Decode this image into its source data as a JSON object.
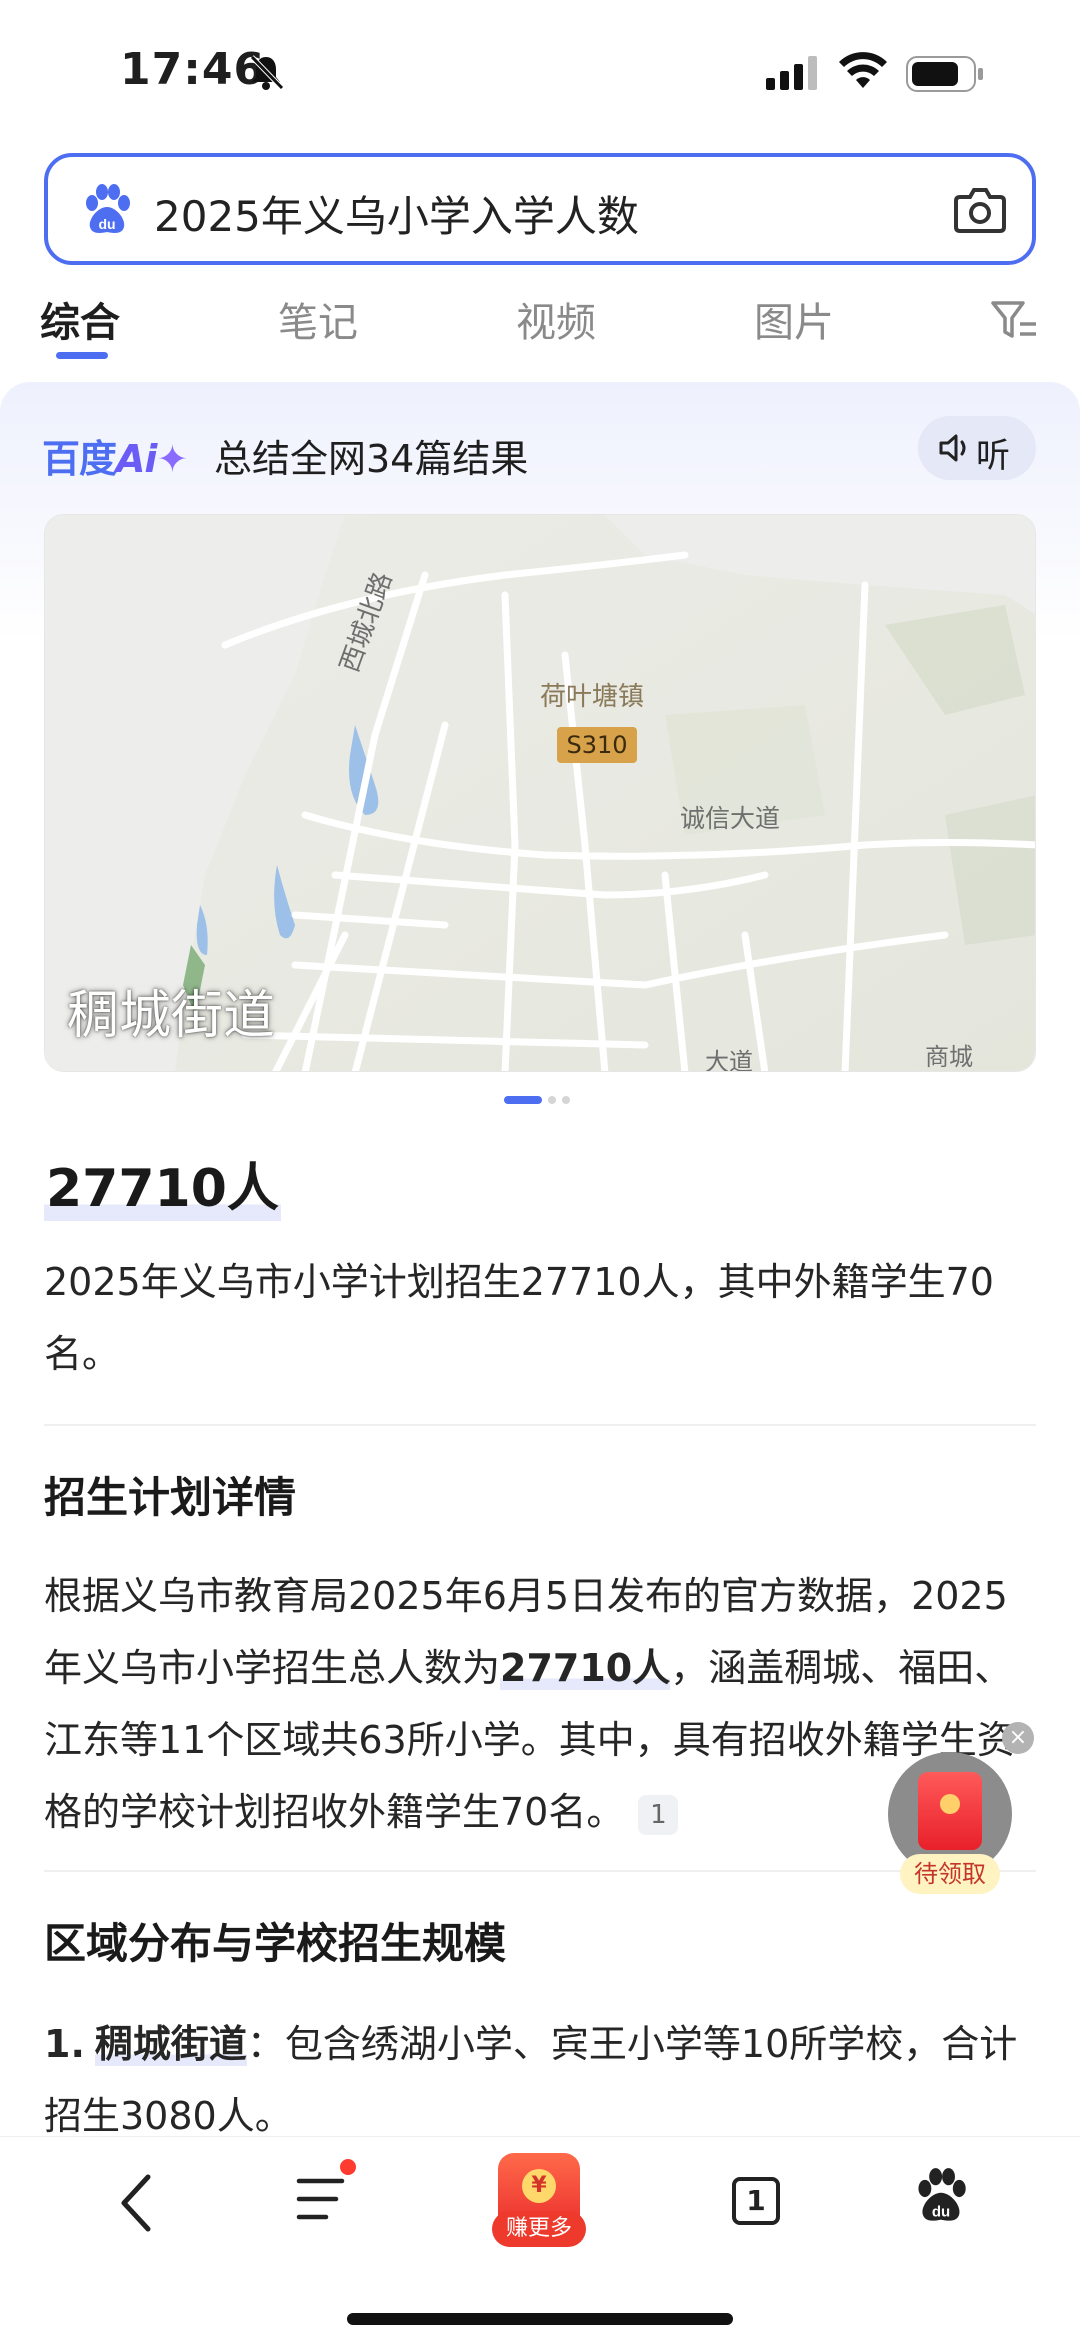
{
  "status_bar": {
    "time": "17:46",
    "icons": [
      "bell-muted-icon",
      "cell-signal-icon",
      "wifi-icon",
      "battery-icon"
    ]
  },
  "search": {
    "query": "2025年义乌小学入学人数",
    "icons": [
      "baidu-paw-icon",
      "camera-icon"
    ]
  },
  "tabs": [
    {
      "label": "综合",
      "active": true
    },
    {
      "label": "笔记",
      "active": false
    },
    {
      "label": "视频",
      "active": false
    },
    {
      "label": "图片",
      "active": false
    }
  ],
  "ai": {
    "logo_text": "百度",
    "logo_ai": "Ai",
    "summary": "总结全网34篇结果",
    "listen_label": "听"
  },
  "map": {
    "label": "稠城街道",
    "place_labels": [
      "西城北路",
      "荷叶塘镇",
      "S310",
      "诚信大道",
      "商城",
      "大道"
    ],
    "carousel_count": 3,
    "carousel_active": 0
  },
  "content": {
    "answer": "27710人",
    "summary_text": "2025年义乌市小学计划招生27710人，其中外籍学生70名。",
    "section1_title": "招生计划详情",
    "section1_pre": "根据义乌市教育局2025年6月5日发布的官方数据，2025年义乌市小学招生总人数为",
    "section1_bold": "27710人",
    "section1_post": "，涵盖稠城、福田、江东等11个区域共63所小学。其中，具有招收外籍学生资格的学校计划招收外籍学生70名。",
    "citation": "1",
    "section2_title": "区域分布与学校招生规模",
    "item1_number": "1.",
    "item1_name": "稠城街道",
    "item1_text": "：包含绣湖小学、宾王小学等10所学校，合计招生3080人。"
  },
  "floating": {
    "label": "待领取",
    "close": "×"
  },
  "bottom_nav": {
    "earn_label": "赚更多",
    "earn_coin": "¥",
    "tab_count": "1",
    "menu_has_badge": true
  },
  "colors": {
    "accent": "#4e6ef2",
    "red": "#e8282a"
  }
}
